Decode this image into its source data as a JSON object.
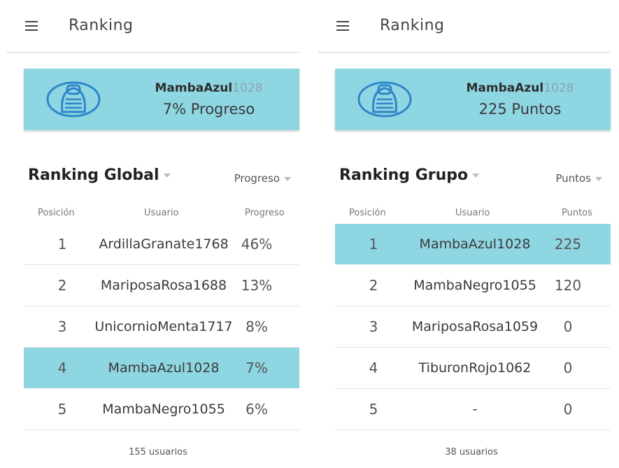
{
  "left": {
    "app_title": "Ranking",
    "card": {
      "user_name": "MambaAzul",
      "user_number": "1028",
      "stat": "7% Progreso"
    },
    "ranking_title": "Ranking Global",
    "metric_select": "Progreso",
    "columns": {
      "position": "Posición",
      "user": "Usuario",
      "value": "Progreso"
    },
    "rows": [
      {
        "pos": "1",
        "user": "ArdillaGranate1768",
        "value": "46%"
      },
      {
        "pos": "2",
        "user": "MariposaRosa1688",
        "value": "13%"
      },
      {
        "pos": "3",
        "user": "UnicornioMenta1717",
        "value": "8%"
      },
      {
        "pos": "4",
        "user": "MambaAzul1028",
        "value": "7%"
      },
      {
        "pos": "5",
        "user": "MambaNegro1055",
        "value": "6%"
      }
    ],
    "footer": "155 usuarios"
  },
  "right": {
    "app_title": "Ranking",
    "card": {
      "user_name": "MambaAzul",
      "user_number": "1028",
      "stat": "225 Puntos"
    },
    "ranking_title": "Ranking Grupo",
    "metric_select": "Puntos",
    "columns": {
      "position": "Posición",
      "user": "Usuario",
      "value": "Puntos"
    },
    "rows": [
      {
        "pos": "1",
        "user": "MambaAzul1028",
        "value": "225"
      },
      {
        "pos": "2",
        "user": "MambaNegro1055",
        "value": "120"
      },
      {
        "pos": "3",
        "user": "MariposaRosa1059",
        "value": "0"
      },
      {
        "pos": "4",
        "user": "TiburonRojo1062",
        "value": "0"
      },
      {
        "pos": "5",
        "user": "-",
        "value": "0"
      }
    ],
    "footer": "38 usuarios"
  },
  "icons": {
    "menu": "menu-icon",
    "avatar": "cobra-avatar-icon",
    "dropdown": "caret-down-icon"
  },
  "colors": {
    "highlight": "#8fd6e3"
  }
}
